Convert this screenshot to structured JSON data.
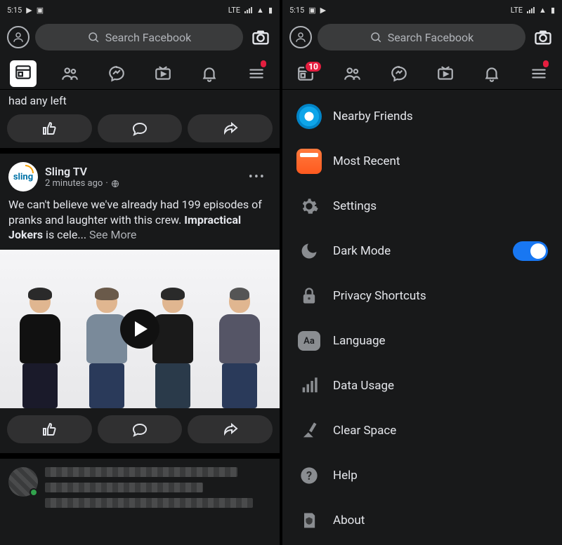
{
  "status": {
    "time": "5:15",
    "network": "LTE"
  },
  "search": {
    "placeholder": "Search Facebook"
  },
  "tabs": {
    "badge_right": "10"
  },
  "feed": {
    "fragment": "had any left",
    "post": {
      "author": "Sling TV",
      "avatar_text": "sling",
      "time": "2 minutes ago",
      "text_pre": "We can't believe we've already had 199 episodes of pranks and laughter with this crew. ",
      "text_bold": "Impractical Jokers",
      "text_post": " is cele... ",
      "see_more": "See More"
    }
  },
  "menu": {
    "items": {
      "nearby": "Nearby Friends",
      "recent": "Most Recent",
      "settings": "Settings",
      "dark_mode": "Dark Mode",
      "privacy": "Privacy Shortcuts",
      "language": "Language",
      "language_badge": "Aa",
      "data_usage": "Data Usage",
      "clear_space": "Clear Space",
      "help": "Help",
      "about": "About"
    },
    "dark_mode_enabled": true
  }
}
